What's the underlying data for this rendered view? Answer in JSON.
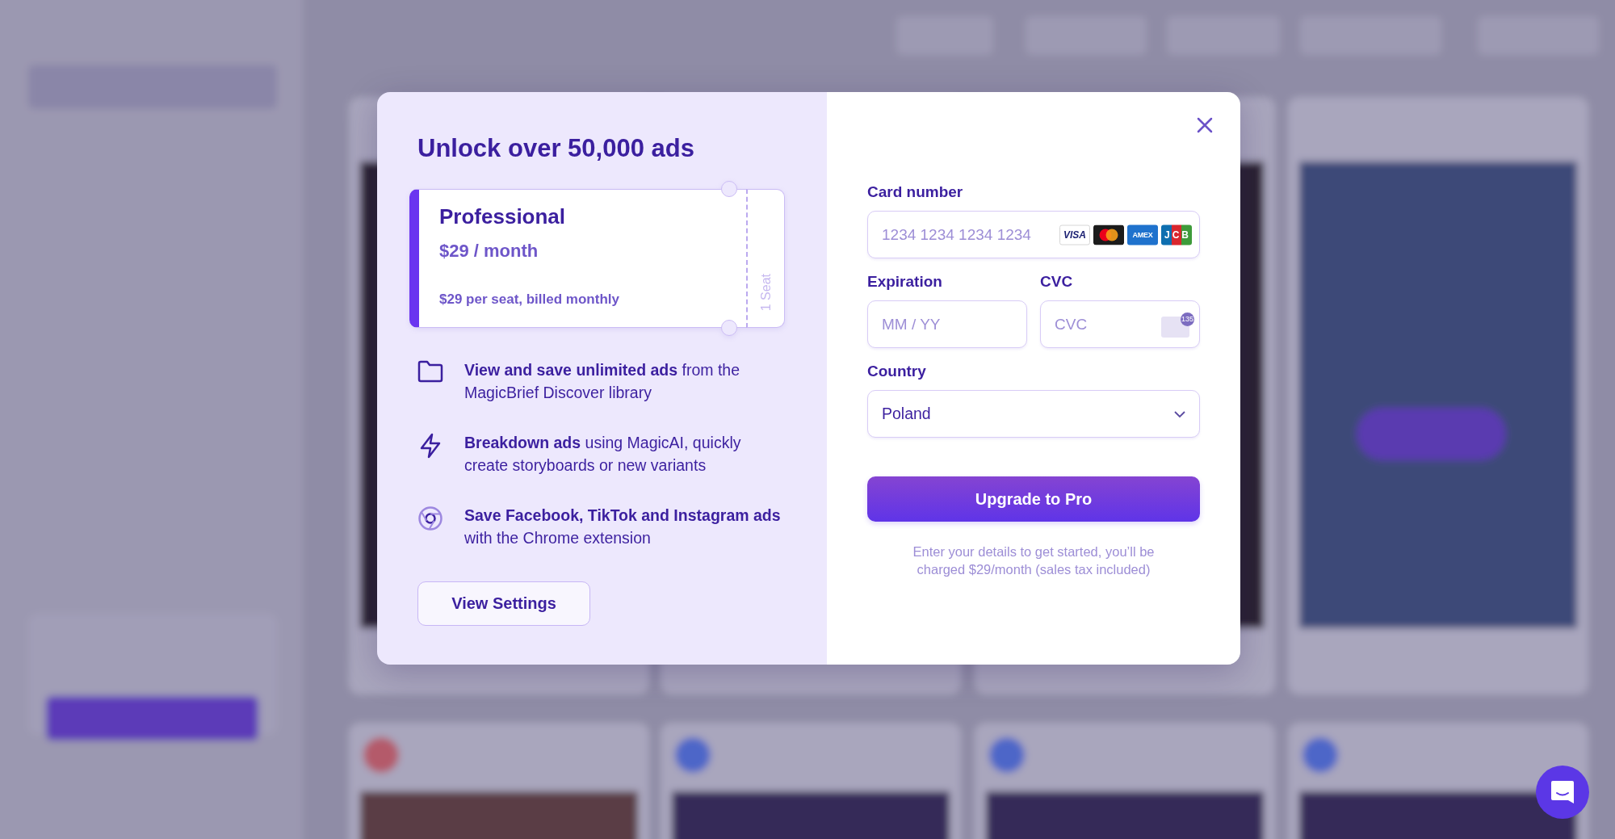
{
  "modal": {
    "title": "Unlock over 50,000 ads",
    "plan": {
      "name": "Professional",
      "price": "$29 / month",
      "billing": "$29 per seat, billed monthly",
      "seats": "1 Seat"
    },
    "features": [
      {
        "kind": "folder",
        "text": "**View and save unlimited ads** from the MagicBrief Discover library"
      },
      {
        "kind": "bolt",
        "text": "**Breakdown ads** using MagicAI, quickly create storyboards or new variants"
      },
      {
        "kind": "chrome",
        "text": "**Save Facebook, TikTok and Instagram ads** with the Chrome extension"
      }
    ],
    "secondary_button": "View Settings",
    "form": {
      "card_label": "Card number",
      "card_placeholder": "1234 1234 1234 1234",
      "card_brands": [
        {
          "kind": "visa",
          "label": "VISA"
        },
        {
          "kind": "mastercard"
        },
        {
          "kind": "amex",
          "label": "AMEX"
        },
        {
          "kind": "jcb",
          "label": "JCB"
        }
      ],
      "expiration_label": "Expiration",
      "expiration_placeholder": "MM / YY",
      "cvc_label": "CVC",
      "cvc_placeholder": "CVC",
      "cvc_hint_code": "135",
      "country_label": "Country",
      "country_value": "Poland"
    },
    "submit_button": "Upgrade to Pro",
    "note": "Enter your details to get started, you’ll be charged $29/month (sales tax included)"
  }
}
